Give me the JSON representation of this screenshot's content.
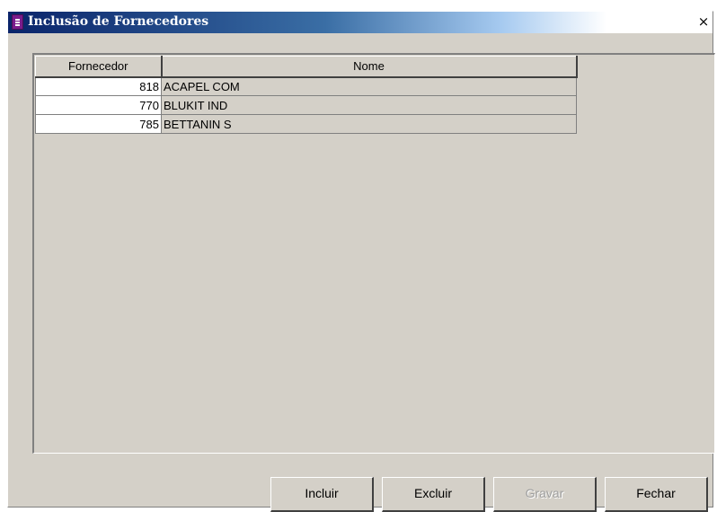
{
  "window": {
    "title": "Inclusão de Fornecedores",
    "close_glyph": "×"
  },
  "table": {
    "columns": [
      "Fornecedor",
      "Nome"
    ],
    "rows": [
      {
        "codigo": "818",
        "nome": "ACAPEL COM"
      },
      {
        "codigo": "770",
        "nome": "BLUKIT IND"
      },
      {
        "codigo": "785",
        "nome": "BETTANIN S"
      }
    ]
  },
  "buttons": {
    "incluir": "Incluir",
    "excluir": "Excluir",
    "gravar": "Gravar",
    "fechar": "Fechar"
  },
  "colors": {
    "title_gradient_start": "#0a246a",
    "title_gradient_end": "#ffffff",
    "face": "#d4d0c8",
    "icon": "#7b1b8c"
  },
  "icons": {
    "title_icon": "document-icon",
    "close_icon": "close-icon"
  }
}
